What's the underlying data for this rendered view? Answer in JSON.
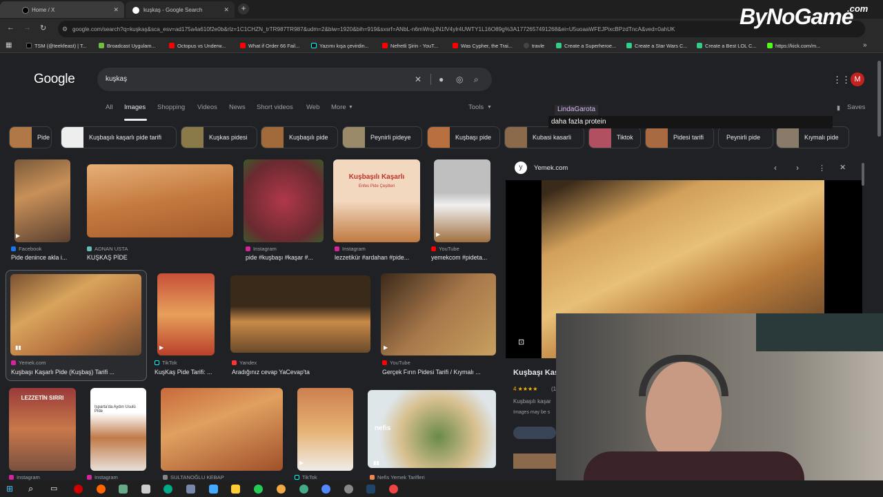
{
  "browser": {
    "tabs": [
      {
        "label": "Home / X",
        "active": false
      },
      {
        "label": "kuşkaş - Google Search",
        "active": true
      }
    ],
    "url": "google.com/search?q=kuşkaş&sca_esv=ad175a4a610f2e0b&rlz=1C1CHZN_trTR987TR987&udm=2&biw=1920&bih=919&sxsrf=ANbL-n6mWrojJN1fV4ylr4UWTY1L16O89g%3A1772657491268&ei=U5uoaaWFEJPixcBPzdTncA&ved=0ahUK",
    "bookmarks": [
      "TSM (@teekfeast) | T...",
      "Broadcast Uygulam...",
      "Octopus vs Underw...",
      "What if Order 66 Fail...",
      "Yazımı kışa çevirdin...",
      "Nefretli Şirin - YouT...",
      "Was Cypher, the Trai...",
      "travle",
      "Create a Superheroe...",
      "Create a Star Wars C...",
      "Create a Best LOL C...",
      "https://kick.com/m..."
    ]
  },
  "google": {
    "logo": "Google",
    "query": "kuşkaş",
    "tabs": [
      "All",
      "Images",
      "Shopping",
      "Videos",
      "News",
      "Short videos",
      "Web",
      "More",
      "Tools"
    ],
    "saves_label": "Saves",
    "avatar_letter": "M",
    "chips": [
      "Pide",
      "Kuşbaşılı kaşarlı pide tarifi",
      "Kuşkas pidesi",
      "Kuşbaşılı pide",
      "Peynirli pideye",
      "Kuşbaşı pide",
      "Kubasi kasarli",
      "Tiktok",
      "Pidesi tarifi",
      "Peynirli pide",
      "Kıymalı pide"
    ],
    "results": [
      {
        "source": "Facebook",
        "caption": "Pide denince akla i..."
      },
      {
        "source": "ADNAN USTA",
        "caption": "KUŞKAŞ PİDE"
      },
      {
        "source": "Instagram",
        "caption": "pide #kuşbaşı #kaşar #..."
      },
      {
        "source": "Instagram",
        "caption": "lezzetikür #ardahan #pide..."
      },
      {
        "source": "YouTube",
        "caption": "yemekcom #pideta..."
      },
      {
        "source": "Yemek.com",
        "caption": "Kuşbaşı Kaşarlı Pide (Kuşbaş) Tarifi ..."
      },
      {
        "source": "TikTok",
        "caption": "KuşKaş Pide Tarifi: ..."
      },
      {
        "source": "Yandex",
        "caption": "Aradığınız cevap YaCevap'ta"
      },
      {
        "source": "YouTube",
        "caption": "Gerçek Fırın Pidesi Tarifi / Kıymalı ..."
      },
      {
        "source": "Instagram",
        "caption": ""
      },
      {
        "source": "Instagram",
        "caption": ""
      },
      {
        "source": "SULTANOĞLU KEBAP",
        "caption": ""
      },
      {
        "source": "TikTok",
        "caption": ""
      },
      {
        "source": "Nefis Yemek Tarifleri",
        "caption": ""
      }
    ],
    "thumb_texts": {
      "r4_title": "Kuşbaşılı Kaşarlı",
      "r4_sub": "Enfes Pide Çeşitleri",
      "r10_title": "LEZZETİN SIRRI",
      "r11_title": "Isparta'da Aydın Usulü Pide",
      "r14_title": "nefis"
    },
    "preview": {
      "site": "Yemek.com",
      "title": "Kuşbaşı Kas",
      "rating": "4 ★★★★",
      "rating_count": "(1",
      "desc": "Kuşbaşılı kaşar",
      "notice": "Images may be s"
    }
  },
  "stream": {
    "logo": "ByNoGame",
    "logo_suffix": ".com",
    "chat_user": "LindaGarota",
    "chat_message": "daha fazla protein"
  },
  "colors": {
    "page_bg": "#202124",
    "search_bg": "#303134",
    "avatar": "#c5221f",
    "chat_user": "#d7b6ff"
  }
}
